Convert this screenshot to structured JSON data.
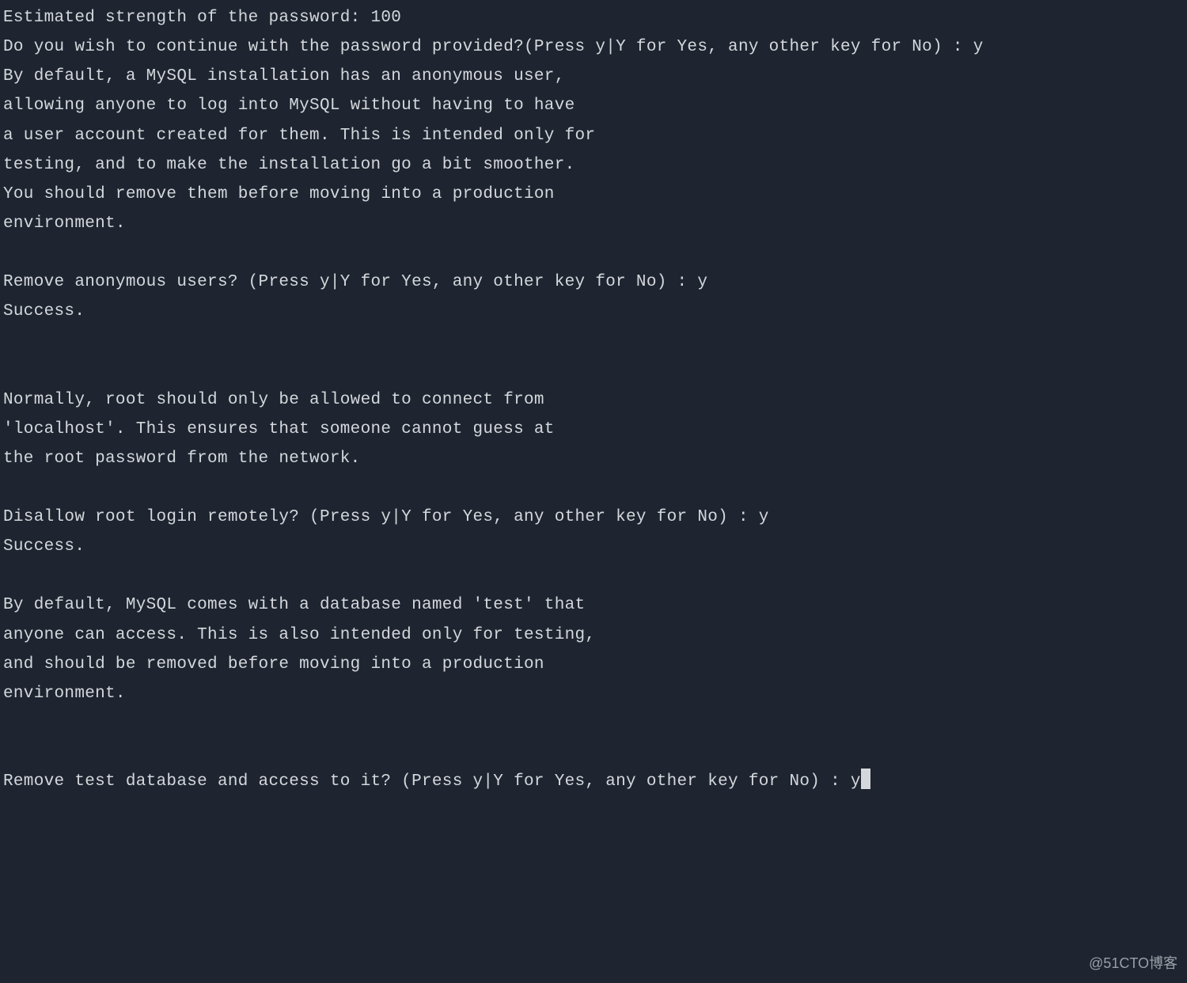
{
  "terminal": {
    "lines": [
      "Estimated strength of the password: 100",
      "Do you wish to continue with the password provided?(Press y|Y for Yes, any other key for No) : y",
      "By default, a MySQL installation has an anonymous user,",
      "allowing anyone to log into MySQL without having to have",
      "a user account created for them. This is intended only for",
      "testing, and to make the installation go a bit smoother.",
      "You should remove them before moving into a production",
      "environment.",
      "",
      "Remove anonymous users? (Press y|Y for Yes, any other key for No) : y",
      "Success.",
      "",
      "",
      "Normally, root should only be allowed to connect from",
      "'localhost'. This ensures that someone cannot guess at",
      "the root password from the network.",
      "",
      "Disallow root login remotely? (Press y|Y for Yes, any other key for No) : y",
      "Success.",
      "",
      "By default, MySQL comes with a database named 'test' that",
      "anyone can access. This is also intended only for testing,",
      "and should be removed before moving into a production",
      "environment.",
      "",
      ""
    ],
    "current_prompt": "Remove test database and access to it? (Press y|Y for Yes, any other key for No) : ",
    "current_input": "y"
  },
  "watermark": "@51CTO博客"
}
